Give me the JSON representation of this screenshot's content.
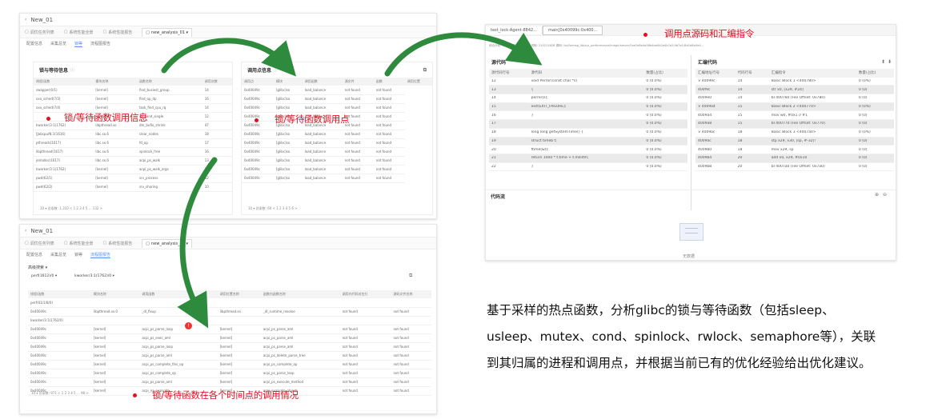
{
  "project_title": "New_01",
  "top_tabs": [
    {
      "label": "调优任务列表"
    },
    {
      "label": "系统性能全景"
    },
    {
      "label": "系统性能报告"
    },
    {
      "label": "new_analysis_01 ▾"
    }
  ],
  "sub_tabs": [
    "配置信息",
    "采集总览",
    "锁等",
    "流程图报告"
  ],
  "window1": {
    "card_left": {
      "title": "锁与等待信息",
      "columns": [
        "线程/函数",
        "模块名称",
        "函数名称",
        "调用次数"
      ],
      "rows": [
        [
          "swapper(0/1)",
          "[kernel]",
          "find_busiest_group",
          "14"
        ],
        [
          "xxx_sched(7/3)",
          "[kernel]",
          "find_op_dp",
          "16"
        ],
        [
          "xxx_sched(7/4)",
          "[kernel]",
          "task_find_cpu_rq",
          "14"
        ],
        [
          "",
          "[kernel]",
          "ipi_send_single",
          "12"
        ],
        [
          "kworker/3:1(1762)",
          "libpthread.so",
          "dm_bufio_shrink",
          "47"
        ],
        [
          "[Jobcpu/N:1(1616)",
          "libc.so.6",
          "clear_nodes",
          "18"
        ],
        [
          "pthreads(1617)",
          "libc.so.6",
          "fd_op",
          "17"
        ],
        [
          "libpthread(1617)",
          "libc.so.6",
          "spinlock_free",
          "16"
        ],
        [
          "jemalloc(1617)",
          "libc.so.6",
          "acpi_ps_walk",
          "13"
        ],
        [
          "kworker/3:1(1762)",
          "[kernel]",
          "acpi_ps_walk_args",
          "11"
        ],
        [
          "pwd(62/1)",
          "[kernel]",
          "srv_process",
          "12"
        ],
        [
          "pwd(62/2)",
          "[kernel]",
          "srv_sharing",
          "10"
        ]
      ],
      "pager": "10 ▾  总条数: 1,310  <  1  2  3  4  5  ...  132  >"
    },
    "card_right": {
      "title": "调用点信息",
      "columns": [
        "调用点",
        "模块",
        "调用函数",
        "源文件",
        "函数",
        "调用位置"
      ],
      "rows": [
        [
          "0x40049c",
          "[glibc]so",
          "load_balance",
          "not found",
          "not found"
        ],
        [
          "0x40049c",
          "[glibc]so",
          "load_balance",
          "not found",
          "not found"
        ],
        [
          "0x40049c",
          "[glibc]so",
          "load_balance",
          "not found",
          "not found"
        ],
        [
          "0x40049c",
          "[glibc]so",
          "load_balance",
          "not found",
          "not found"
        ],
        [
          "0x40049c",
          "[glibc]so",
          "load_balance",
          "not found",
          "not found"
        ],
        [
          "0x40049c",
          "[glibc]so",
          "load_balance",
          "not found",
          "not found"
        ],
        [
          "0x40049c",
          "[glibc]so",
          "load_balance",
          "not found",
          "not found"
        ],
        [
          "0x40049c",
          "[glibc]so",
          "load_balance",
          "not found",
          "not found"
        ],
        [
          "0x40049c",
          "[glibc]so",
          "load_balance",
          "not found",
          "not found"
        ],
        [
          "0x40049c",
          "[glibc]so",
          "load_balance",
          "not found",
          "not found"
        ],
        [
          "0x40049c",
          "[glibc]so",
          "load_balance",
          "not found",
          "not found"
        ]
      ],
      "pager": "10 ▾  总条数: 60  <  1  2  3  4  5  6  >"
    }
  },
  "window2": {
    "filter_label": "高级搜索 ▾",
    "filters": [
      "perf(1612)/0 ▾",
      "kworker/3:1(1762)/0 ▾"
    ],
    "columns": [
      "线程/函数",
      "模块名称",
      "调用函数",
      "调用位置名称",
      "函数内函数名称",
      "调用内代码对应行",
      "源码文件名称"
    ],
    "rows": [
      [
        "perf(61/1/8/0)",
        "",
        "",
        "",
        "",
        "",
        ""
      ],
      [
        "0x40049c",
        "libpthread.so.0",
        "_dl_fixup",
        "libpthread.so",
        "_dl_runtime_resolve",
        "not found",
        "not found"
      ],
      [
        "kworker/3:1(1762/0)",
        "",
        "",
        "",
        "",
        "",
        ""
      ],
      [
        "0x40049c",
        "[kernel]",
        "acpi_ps_parse_loop",
        "[kernel]",
        "acpi_ps_parse_aml",
        "not found",
        "not found"
      ],
      [
        "0x40049c",
        "[kernel]",
        "acpi_ps_exec_aml",
        "[kernel]",
        "acpi_ps_parse_aml",
        "not found",
        "not found"
      ],
      [
        "0x40049c",
        "[kernel]",
        "acpi_ps_parse_loop",
        "[kernel]",
        "acpi_ps_parse_aml",
        "not found",
        "not found"
      ],
      [
        "0x40049c",
        "[kernel]",
        "acpi_ps_parse_aml",
        "[kernel]",
        "acpi_ps_delete_parse_tree",
        "not found",
        "not found"
      ],
      [
        "0x40049c",
        "[kernel]",
        "acpi_ps_complete_this_op",
        "[kernel]",
        "acpi_ps_complete_op",
        "not found",
        "not found"
      ],
      [
        "0x40049c",
        "[kernel]",
        "acpi_ps_complete_op",
        "[kernel]",
        "acpi_ps_parse_loop",
        "not found",
        "not found"
      ],
      [
        "0x40049c",
        "[kernel]",
        "acpi_ps_parse_aml",
        "[kernel]",
        "acpi_ps_execute_method",
        "not found",
        "not found"
      ],
      [
        "0x40049c",
        "[kernel]",
        "acpi_ns_evaluate",
        "[kernel]",
        "acpi_evaluate_object",
        "not found",
        "not found"
      ]
    ],
    "pager": "10 ▾  总条数: 971  <  1  2  3  4  5  ...  98  >"
  },
  "window3": {
    "file_tabs": [
      "test_lock-Agent-8842...",
      "main[0x40099c:0x400..."
    ],
    "info_line": "综合分析: CPU 使用率 ...  主机 / 进程: 210211828  源码: /ss/formsg_lib/xyz_performance/image/server/0xe2d8e4a58b4ba0b2e4b7a2/4b7e1/8d1b8e/fa4...",
    "source_panel": {
      "title": "源代码",
      "columns": [
        "源代码行号",
        "源代码",
        "数量(占比)"
      ],
      "rows": [
        [
          "12",
          "void Perror(const char *s)",
          "0 (0.0%)"
        ],
        [
          "13",
          "{",
          "0 (0.0%)"
        ],
        [
          "14",
          "perror(s);",
          "0 (0.0%)"
        ],
        [
          "15",
          "exit(EXIT_FAILURE);",
          "0 (0.0%)"
        ],
        [
          "16",
          "}",
          "0 (0.0%)"
        ],
        [
          "17",
          "",
          "0 (0.0%)"
        ],
        [
          "18",
          "long long getSystemTime() {",
          "0 (0.0%)"
        ],
        [
          "19",
          "struct timeb t;",
          "0 (0.0%)"
        ],
        [
          "20",
          "ftime(&t);",
          "0 (0.0%)"
        ],
        [
          "21",
          "return 1000 * t.time + t.millitm;",
          "0 (0.0%)"
        ],
        [
          "22",
          "}",
          "0 (0.0%)"
        ]
      ]
    },
    "asm_panel": {
      "title": "汇编代码",
      "columns": [
        "汇编地址行号",
        "代码行号",
        "汇编指令",
        "数量(占比)"
      ],
      "rows": [
        [
          "∨ 40099c",
          "14",
          "Basic Block 1 <400780>",
          "0 (0%)"
        ],
        [
          "400f9c",
          "14",
          "str x0, [x29, #24]",
          "0 (0)"
        ],
        [
          "4009e0",
          "14",
          "bl 400780 (File Offset: 0x780)",
          "0 (0)"
        ],
        [
          "∨ 4009a4",
          "15",
          "Basic Block 2 <400770>",
          "0 (0%)"
        ],
        [
          "4009a4",
          "15",
          "mov w0, #0x1 // #1",
          "0 (0)"
        ],
        [
          "4009a8",
          "15",
          "bl 400770 (File Offset: 0x770)",
          "0 (0)"
        ],
        [
          "∨ 4009ac",
          "18",
          "Basic Block 3 <4007a0>",
          "0 (0%)"
        ],
        [
          "4009ac",
          "18",
          "stp x29, x30, [sp, #-32]!",
          "0 (0)"
        ],
        [
          "4009b0",
          "18",
          "mov x29, sp",
          "0 (0)"
        ],
        [
          "4009b4",
          "20",
          "add x0, x29, #0x10",
          "0 (0)"
        ],
        [
          "4009b8",
          "20",
          "bl 4007a0 (File Offset: 0x7a0)",
          "0 (0)"
        ]
      ]
    },
    "flow_title": "代码流",
    "empty_text": "无数据"
  },
  "annotations": {
    "lock_call_info": "锁/等待函数调用信息",
    "lock_call_point": "锁/等待函数调用点",
    "source_asm": "调用点源码和汇编指令",
    "time_point": "锁/等待函数在各个时间点的调用情况"
  },
  "description": "基于采样的热点函数，分析glibc的锁与等待函数（包括sleep、usleep、mutex、cond、spinlock、rwlock、semaphore等），关联到其归属的进程和调用点，并根据当前已有的优化经验给出优化建议。",
  "colors": {
    "annotation": "#e01020",
    "arrow": "#2e8b3e",
    "accent": "#5b8ff9"
  }
}
